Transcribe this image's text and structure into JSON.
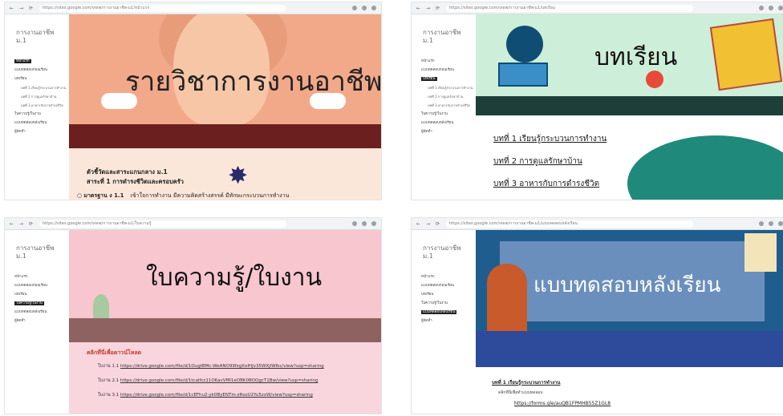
{
  "panels": [
    {
      "url": "https://sites.google.com/view/การงานอาชีพ-ม1/หน้าแรก",
      "site_title": "การงานอาชีพ ม.1",
      "nav": [
        {
          "label": "หน้าแรก",
          "active": true
        },
        {
          "label": "แบบทดสอบก่อนเรียน",
          "active": false
        },
        {
          "label": "บทเรียน",
          "active": false
        },
        {
          "label": "บทที่ 1 เรียนรู้กระบวนการทำงาน",
          "active": false,
          "sub": true
        },
        {
          "label": "บทที่ 2 การดูแลรักษาบ้าน",
          "active": false,
          "sub": true
        },
        {
          "label": "บทที่ 3 อาหารกับการดำรงชีวิต",
          "active": false,
          "sub": true
        },
        {
          "label": "ใบความรู้/ใบงาน",
          "active": false
        },
        {
          "label": "แบบทดสอบหลังเรียน",
          "active": false
        },
        {
          "label": "ผู้จัดทำ",
          "active": false
        }
      ],
      "hero_title": "รายวิชาการงานอาชีพ",
      "heading1": "ตัวชี้วัดและสาระแกนกลาง ม.1",
      "heading2": "สาระที่ 1 การดำรงชีวิตและครอบครัว",
      "standard_label": "มาตรฐาน ง 1.1",
      "standard_text": "เข้าใจการทำงาน มีความคิดสร้างสรรค์ มีทักษะกระบวนการทำงาน"
    },
    {
      "url": "https://sites.google.com/view/การงานอาชีพ-ม1/บทเรียน",
      "site_title": "การงานอาชีพ ม.1",
      "nav": [
        {
          "label": "หน้าแรก",
          "active": false
        },
        {
          "label": "แบบทดสอบก่อนเรียน",
          "active": false
        },
        {
          "label": "บทเรียน",
          "active": true
        },
        {
          "label": "บทที่ 1 เรียนรู้กระบวนการทำงาน",
          "active": false,
          "sub": true
        },
        {
          "label": "บทที่ 2 การดูแลรักษาบ้าน",
          "active": false,
          "sub": true
        },
        {
          "label": "บทที่ 3 อาหารกับการดำรงชีวิต",
          "active": false,
          "sub": true
        },
        {
          "label": "ใบความรู้/ใบงาน",
          "active": false
        },
        {
          "label": "แบบทดสอบหลังเรียน",
          "active": false
        },
        {
          "label": "ผู้จัดทำ",
          "active": false
        }
      ],
      "hero_title": "บทเรียน",
      "lessons": [
        "บทที่ 1 เรียนรู้กระบวนการทำงาน",
        "บทที่ 2 การดูแลรักษาบ้าน",
        "บทที่ 3 อาหารกับการดำรงชีวิต"
      ]
    },
    {
      "url": "https://sites.google.com/view/การงานอาชีพ-ม1/ใบความรู้",
      "site_title": "การงานอาชีพ ม.1",
      "nav": [
        {
          "label": "หน้าแรก",
          "active": false
        },
        {
          "label": "แบบทดสอบก่อนเรียน",
          "active": false
        },
        {
          "label": "บทเรียน",
          "active": false
        },
        {
          "label": "ใบความรู้/ใบงาน",
          "active": true
        },
        {
          "label": "แบบทดสอบหลังเรียน",
          "active": false
        },
        {
          "label": "ผู้จัดทำ",
          "active": false
        }
      ],
      "hero_title": "ใบความรู้/ใบงาน",
      "download_title": "คลิกที่นี่เพื่อดาวน์โหลด",
      "links": [
        {
          "label": "ใบงาน 1.1",
          "url": "https://drive.google.com/file/d/1OugtBMc-WeANO99fzgXoIHJv35WXjlWlkc/view?usp=sharing"
        },
        {
          "label": "ใบงาน 2.1",
          "url": "https://drive.google.com/file/d/1tcalfcz11OKavVMI1eOBK0BOOgcT1Bw/view?usp=sharing"
        },
        {
          "label": "ใบงาน 3.1",
          "url": "https://drive.google.com/file/d/1cEFhu2-yk0ByENTm-zRsoU2Yu5zxW/view?usp=sharing"
        }
      ]
    },
    {
      "url": "https://sites.google.com/view/การงานอาชีพ-ม1/แบบทดสอบหลังเรียน",
      "site_title": "การงานอาชีพ ม.1",
      "nav": [
        {
          "label": "หน้าแรก",
          "active": false
        },
        {
          "label": "แบบทดสอบก่อนเรียน",
          "active": false
        },
        {
          "label": "บทเรียน",
          "active": false
        },
        {
          "label": "ใบความรู้/ใบงาน",
          "active": false
        },
        {
          "label": "แบบทดสอบหลังเรียน",
          "active": true
        },
        {
          "label": "ผู้จัดทำ",
          "active": false
        }
      ],
      "hero_title": "แบบทดสอบหลังเรียน",
      "exam_title": "บทที่ 1 เรียนรู้กระบวนการทำงาน",
      "exam_hint": "คลิกที่นี่เพื่อทำแบบทดสอบ",
      "exam_link": "https://forms.gle/auQB1FPMHB55Z1GL8"
    }
  ]
}
